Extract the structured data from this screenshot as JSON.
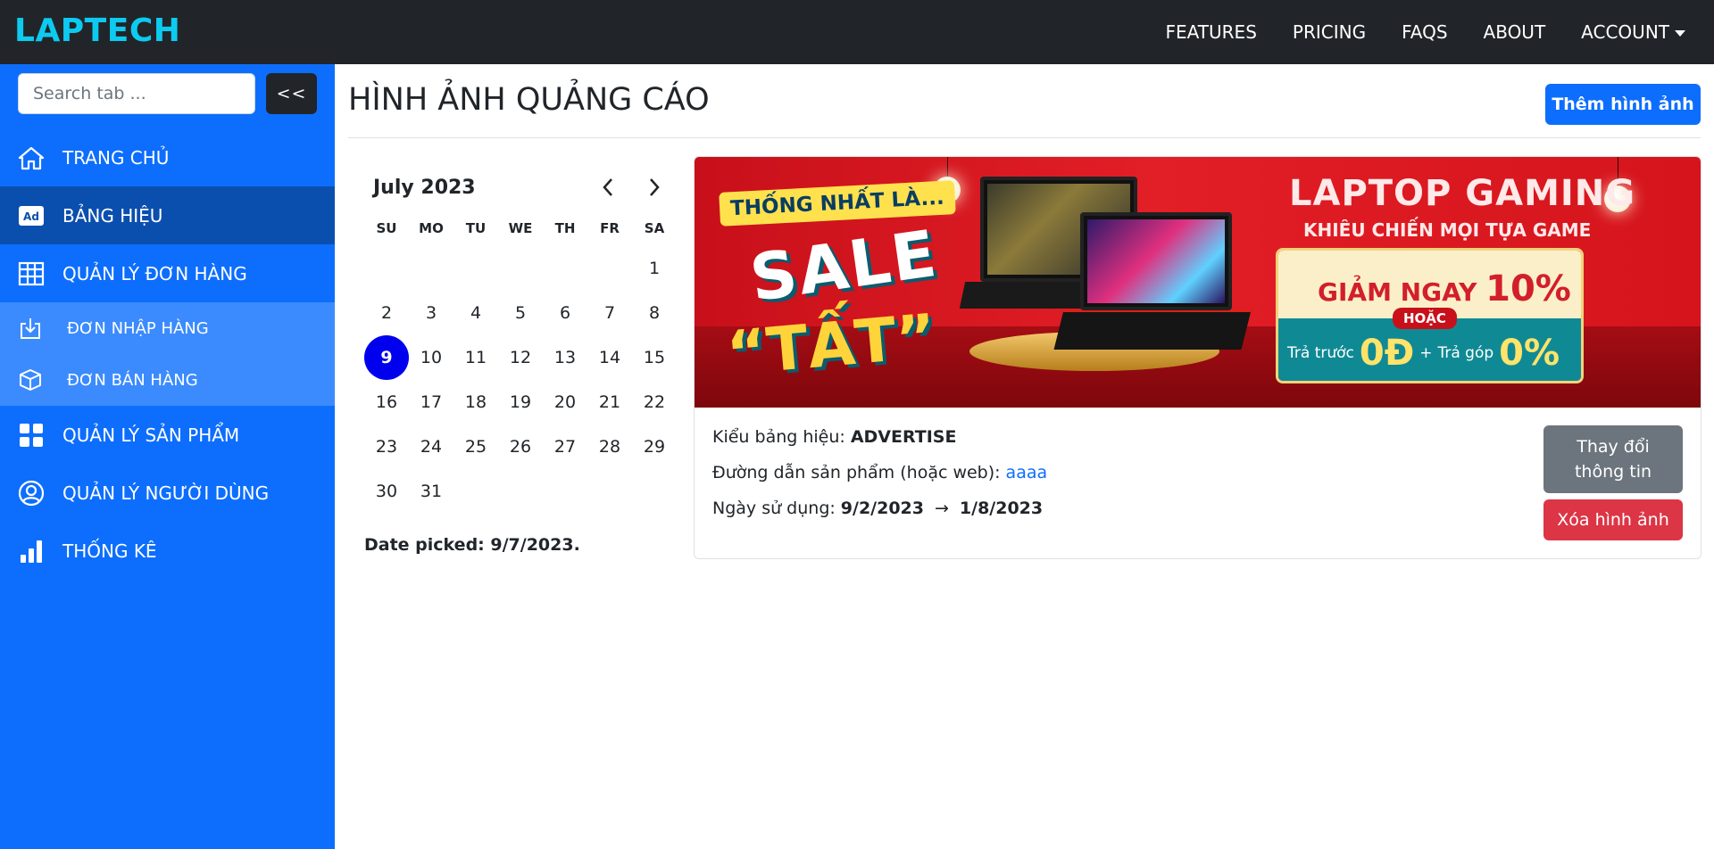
{
  "brand": "LAPTECH",
  "topnav": {
    "features": "FEATURES",
    "pricing": "PRICING",
    "faqs": "FAQS",
    "about": "ABOUT",
    "account": "ACCOUNT"
  },
  "sidebar": {
    "search_placeholder": "Search tab ...",
    "collapse_label": "<<",
    "items": [
      {
        "label": "TRANG CHỦ",
        "icon": "home-icon"
      },
      {
        "label": "BẢNG HIỆU",
        "icon": "ad-icon",
        "active": true
      },
      {
        "label": "QUẢN LÝ ĐƠN HÀNG",
        "icon": "table-icon"
      },
      {
        "label": "ĐƠN NHẬP HÀNG",
        "icon": "download-icon",
        "sub": true
      },
      {
        "label": "ĐƠN BÁN HÀNG",
        "icon": "box-icon",
        "sub": true
      },
      {
        "label": "QUẢN LÝ SẢN PHẨM",
        "icon": "grid-icon"
      },
      {
        "label": "QUẢN LÝ NGƯỜI DÙNG",
        "icon": "user-circle-icon"
      },
      {
        "label": "THỐNG KÊ",
        "icon": "bar-chart-icon"
      }
    ]
  },
  "main": {
    "title": "HÌNH ẢNH QUẢNG CÁO",
    "add_button": "Thêm hình ảnh"
  },
  "calendar": {
    "month_label": "July 2023",
    "weekdays": [
      "SU",
      "MO",
      "TU",
      "WE",
      "TH",
      "FR",
      "SA"
    ],
    "days": [
      "",
      "",
      "",
      "",
      "",
      "",
      "1",
      "2",
      "3",
      "4",
      "5",
      "6",
      "7",
      "8",
      "9",
      "10",
      "11",
      "12",
      "13",
      "14",
      "15",
      "16",
      "17",
      "18",
      "19",
      "20",
      "21",
      "22",
      "23",
      "24",
      "25",
      "26",
      "27",
      "28",
      "29",
      "30",
      "31",
      "",
      "",
      "",
      "",
      ""
    ],
    "selected_day": "9",
    "date_picked": "Date picked: 9/7/2023."
  },
  "card": {
    "banner": {
      "tag": "THỐNG NHẤT LÀ...",
      "sale": "SALE",
      "tat": "“TẤT”",
      "gaming_title": "LAPTOP GAMING",
      "gaming_sub": "KHIÊU CHIẾN MỌI TỰA GAME",
      "giam_ngay": "GIẢM NGAY",
      "discount": "10%",
      "hoac": "HOẶC",
      "tra_truoc": "Trả trước",
      "zero_d": "0Đ",
      "plus": "+",
      "tra_gop": "Trả góp",
      "zero_percent": "0%"
    },
    "kieu_label": "Kiểu bảng hiệu:",
    "kieu_value": "ADVERTISE",
    "duong_dan_label": "Đường dẫn sản phẩm (hoặc web):",
    "duong_dan_value": "aaaa",
    "ngay_label": "Ngày sử dụng:",
    "ngay_start": "9/2/2023",
    "ngay_arrow": "→",
    "ngay_end": "1/8/2023",
    "edit_button": "Thay đổi thông tin",
    "delete_button": "Xóa hình ảnh"
  },
  "colors": {
    "navbar": "#212529",
    "brand": "#0dcaf0",
    "sidebar": "#0d6efd",
    "sidebar_active": "#0b4fae",
    "sidebar_sub": "#3b8bfe",
    "primary": "#0d6efd",
    "secondary": "#6c757d",
    "danger": "#dc3545",
    "selected_day": "#0000ee"
  }
}
